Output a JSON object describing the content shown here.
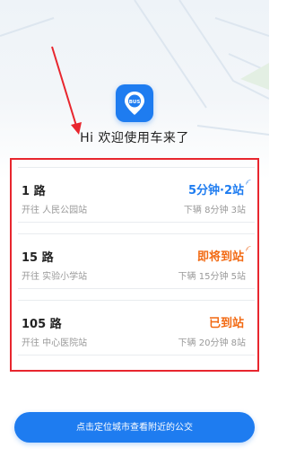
{
  "welcome_text": "Hi 欢迎使用车来了",
  "app_icon": {
    "name": "bus-pin-icon",
    "label": "BUS"
  },
  "routes": [
    {
      "name": "1 路",
      "destination": "开往 人民公园站",
      "status": "5分钟·2站",
      "status_color": "#1e7cf0",
      "next": "下辆 8分钟 3站"
    },
    {
      "name": "15 路",
      "destination": "开往 实验小学站",
      "status": "即将到站",
      "status_color": "#f26a13",
      "next": "下辆 15分钟 5站"
    },
    {
      "name": "105 路",
      "destination": "开往 中心医院站",
      "status": "已到站",
      "status_color": "#f26a13",
      "next": "下辆 20分钟 8站"
    }
  ],
  "locate_button_label": "点击定位城市查看附近的公交",
  "colors": {
    "accent": "#1e7cf0",
    "arriving": "#f26a13",
    "annotation": "#e8262e"
  }
}
